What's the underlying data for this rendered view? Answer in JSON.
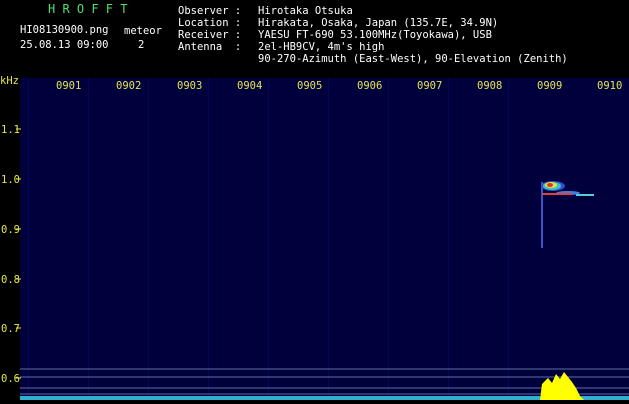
{
  "header": {
    "app_title": "H R O F F T",
    "filename": "HI08130900.png",
    "datetime": "25.08.13 09:00",
    "meteor_label": "meteor",
    "meteor_count": "2"
  },
  "info": {
    "observer_label": "Observer :",
    "observer": "Hirotaka Otsuka",
    "location_label": "Location :",
    "location": "Hirakata, Osaka, Japan (135.7E, 34.9N)",
    "receiver_label": "Receiver :",
    "receiver": "YAESU FT-690 53.100MHz(Toyokawa), USB",
    "antenna_label": "Antenna  :",
    "antenna_line1": "2el-HB9CV, 4m's high",
    "antenna_line2": "90-270-Azimuth (East-West), 90-Elevation (Zenith)"
  },
  "plot": {
    "y_unit": "kHz",
    "y_ticks": [
      "1.1",
      "1.0",
      "0.9",
      "0.8",
      "0.7",
      "0.6"
    ],
    "x_ticks": [
      "0901",
      "0902",
      "0903",
      "0904",
      "0905",
      "0906",
      "0907",
      "0908",
      "0909",
      "0910"
    ]
  },
  "colors": {
    "background": "#000000",
    "spectrogram_bg": "#00003c",
    "tick_text": "#e6e64a",
    "title_text": "#4fe06a",
    "info_text": "#ffffff"
  }
}
